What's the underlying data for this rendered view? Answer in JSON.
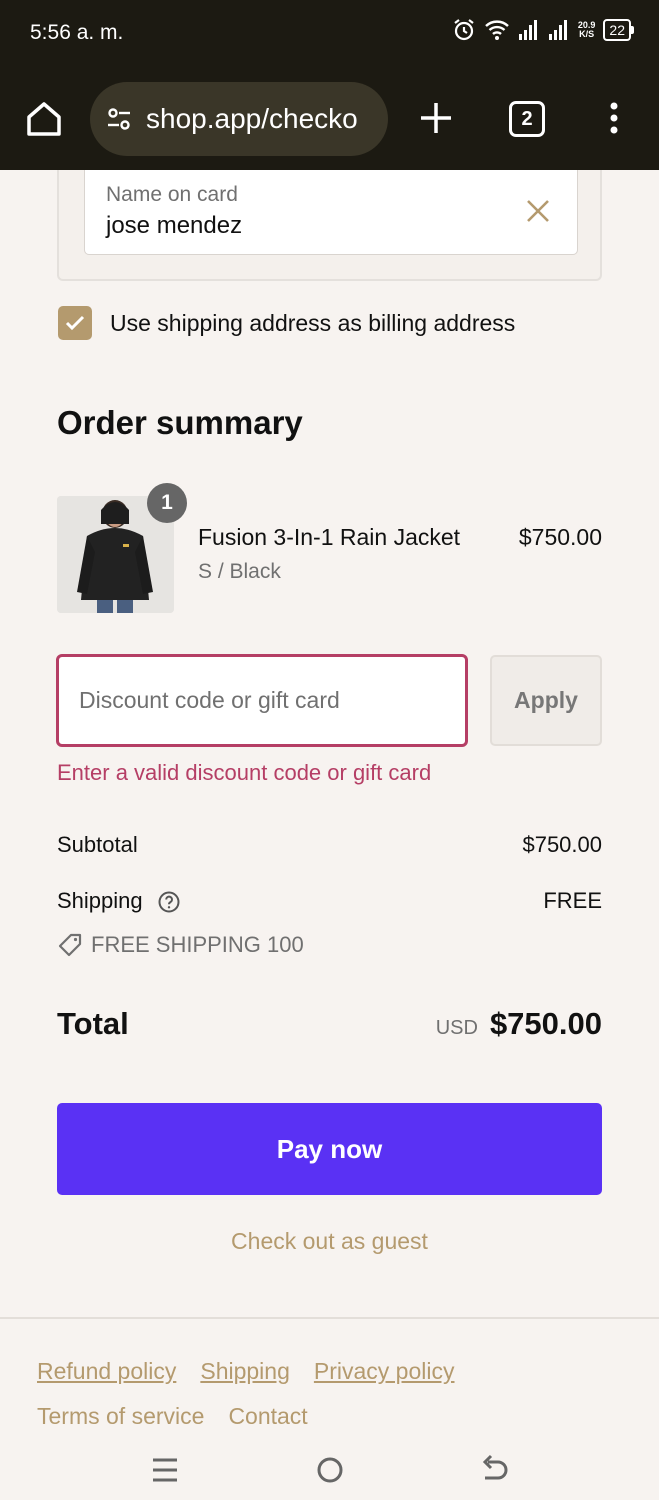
{
  "status_bar": {
    "time": "5:56 a. m.",
    "net_speed_value": "20.9",
    "net_speed_unit": "K/S",
    "battery": "22"
  },
  "browser": {
    "url": "shop.app/checko",
    "tab_count": "2"
  },
  "payment": {
    "name_label": "Name on card",
    "name_value": "jose mendez",
    "billing_label": "Use shipping address as billing address"
  },
  "order_summary": {
    "title": "Order summary",
    "product": {
      "quantity": "1",
      "name": "Fusion 3-In-1 Rain Jacket",
      "variant": "S / Black",
      "price": "$750.00"
    },
    "discount": {
      "placeholder": "Discount code or gift card",
      "apply_label": "Apply",
      "error": "Enter a valid discount code or gift card"
    },
    "subtotal_label": "Subtotal",
    "subtotal_value": "$750.00",
    "shipping_label": "Shipping",
    "shipping_value": "FREE",
    "promo": "FREE SHIPPING 100",
    "total_label": "Total",
    "currency": "USD",
    "total_value": "$750.00"
  },
  "actions": {
    "pay_label": "Pay now",
    "guest_label": "Check out as guest"
  },
  "footer": {
    "refund": "Refund policy",
    "shipping": "Shipping",
    "privacy": "Privacy policy",
    "terms": "Terms of service",
    "contact": "Contact"
  },
  "colors": {
    "accent": "#b49a6e",
    "pay_button": "#5a31f4",
    "error": "#b53e65"
  }
}
